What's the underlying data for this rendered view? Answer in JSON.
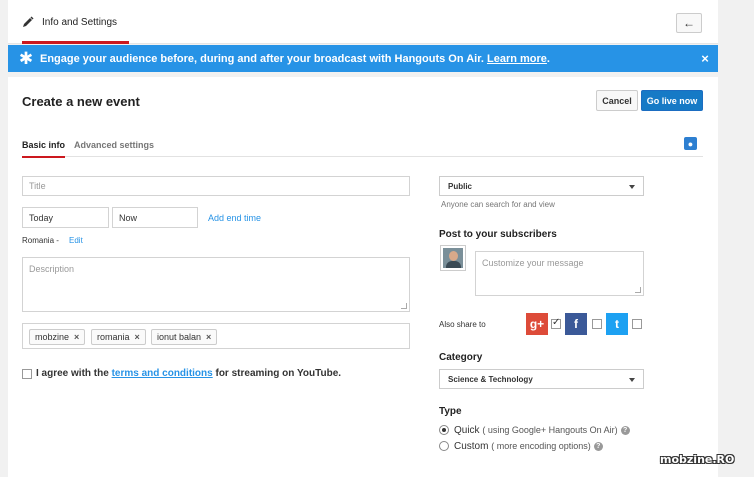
{
  "topbar": {
    "tab_label": "Info and Settings",
    "back_icon": "arrow-left-icon"
  },
  "banner": {
    "message": "Engage your audience before, during and after your broadcast with Hangouts On Air.",
    "link": "Learn more",
    "period": ".",
    "close": "×",
    "icon": "asterisk-icon"
  },
  "event": {
    "heading": "Create a new event",
    "cancel_label": "Cancel",
    "go_live_label": "Go live now",
    "tabs": [
      "Basic info",
      "Advanced settings"
    ]
  },
  "form": {
    "title_placeholder": "Title",
    "date_value": "Today",
    "time_value": "Now",
    "add_end_time": "Add end time",
    "timezone": "Romania -",
    "edit_label": "Edit",
    "description_placeholder": "Description",
    "tags": [
      "mobzine",
      "romania",
      "ionut balan"
    ],
    "tag_remove": "×",
    "agree_prefix": "I agree with the",
    "agree_link": "terms and conditions",
    "agree_suffix": "for streaming on YouTube."
  },
  "sidebar": {
    "privacy_value": "Public",
    "privacy_hint": "Anyone can search for and view",
    "post_title": "Post to your subscribers",
    "message_placeholder": "Customize your message",
    "share_label": "Also share to",
    "category_title": "Category",
    "category_value": "Science & Technology",
    "type_title": "Type",
    "type_quick": "Quick",
    "type_quick_note": "( using Google+ Hangouts On Air)",
    "type_custom": "Custom",
    "type_custom_note": "( more encoding options)",
    "help_glyph": "?"
  },
  "social": {
    "gplus": "g+",
    "facebook": "f",
    "twitter": "t"
  },
  "colors": {
    "accent_red": "#cc181e",
    "banner_blue": "#2793e6",
    "button_blue": "#167ac6",
    "gplus_red": "#dd4b39",
    "facebook_blue": "#3b5998",
    "twitter_blue": "#1da1f2"
  },
  "watermark": "mobzine.RO"
}
